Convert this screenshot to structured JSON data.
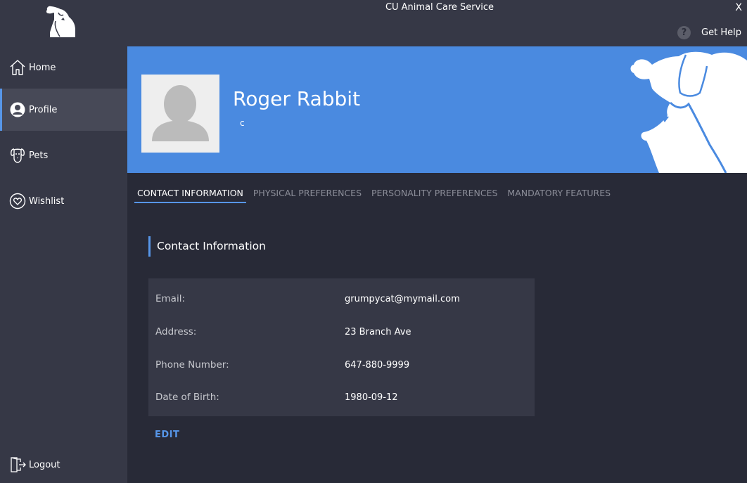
{
  "window": {
    "title": "CU Animal Care Service",
    "close_label": "X",
    "help_label": "Get Help",
    "help_icon_glyph": "?"
  },
  "sidebar": {
    "items": [
      {
        "label": "Home",
        "icon": "home-icon"
      },
      {
        "label": "Profile",
        "icon": "profile-icon",
        "active": true
      },
      {
        "label": "Pets",
        "icon": "dog-face-icon"
      },
      {
        "label": "Wishlist",
        "icon": "heart-icon"
      }
    ],
    "logout_label": "Logout"
  },
  "profile": {
    "name": "Roger Rabbit",
    "subtitle": "c"
  },
  "tabs": [
    {
      "label": "CONTACT INFORMATION",
      "active": true
    },
    {
      "label": "PHYSICAL PREFERENCES"
    },
    {
      "label": "PERSONALITY PREFERENCES"
    },
    {
      "label": "MANDATORY FEATURES"
    }
  ],
  "contact": {
    "section_title": "Contact Information",
    "rows": [
      {
        "label": "Email:",
        "value": "grumpycat@mymail.com"
      },
      {
        "label": "Address:",
        "value": "23 Branch Ave"
      },
      {
        "label": "Phone Number:",
        "value": "647-880-9999"
      },
      {
        "label": "Date of Birth:",
        "value": "1980-09-12"
      }
    ],
    "edit_label": "EDIT"
  },
  "colors": {
    "accent": "#5796e8",
    "banner": "#4a8ae0",
    "sidebar": "#363846",
    "background": "#282a37"
  }
}
